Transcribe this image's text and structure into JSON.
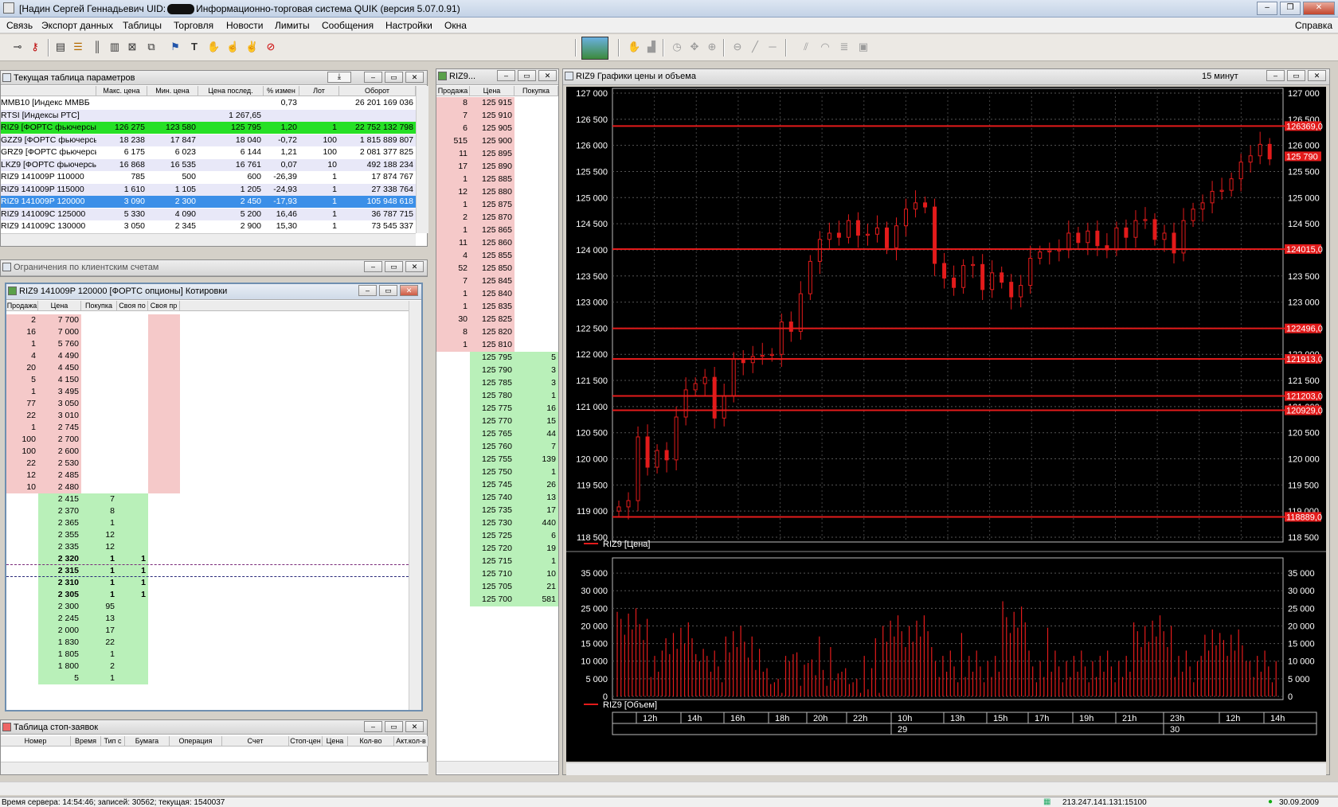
{
  "window": {
    "title_prefix": "[Надин Сергей Геннадьевич  UID:",
    "title_suffix": "Информационно-торговая система QUIK (версия 5.07.0.91)",
    "min": "–",
    "max": "❐",
    "close": "✕"
  },
  "menu": [
    "Связь",
    "Экспорт данных",
    "Таблицы",
    "Торговля",
    "Новости",
    "Лимиты",
    "Сообщения",
    "Настройки",
    "Окна"
  ],
  "menu_help": "Справка",
  "params": {
    "title": "Текущая таблица параметров",
    "headers": [
      "",
      "Макс. цена",
      "Мин. цена",
      "Цена послед.",
      "% измен",
      "Лот",
      "Оборот"
    ],
    "rows": [
      {
        "name": "MMB10 [Индекс ММВБ",
        "max": "",
        "min": "",
        "last": "",
        "chg": "0,73",
        "lot": "",
        "turn": "26 201 169 036",
        "hl": "none"
      },
      {
        "name": "RTSI [Индексы РТС]",
        "max": "",
        "min": "",
        "last": "1 267,65",
        "chg": "",
        "lot": "",
        "turn": "",
        "hl": "lav"
      },
      {
        "name": "RIZ9 [ФОРТС фьючерсы]",
        "max": "126 275",
        "min": "123 580",
        "last": "125 795",
        "chg": "1,20",
        "lot": "1",
        "turn": "22 752 132 798",
        "hl": "green"
      },
      {
        "name": "GZZ9 [ФОРТС фьючерсы",
        "max": "18 238",
        "min": "17 847",
        "last": "18 040",
        "chg": "-0,72",
        "lot": "100",
        "turn": "1 815 889 807",
        "hl": "lav"
      },
      {
        "name": "GRZ9 [ФОРТС фьючерсы",
        "max": "6 175",
        "min": "6 023",
        "last": "6 144",
        "chg": "1,21",
        "lot": "100",
        "turn": "2 081 377 825",
        "hl": "none"
      },
      {
        "name": "LKZ9 [ФОРТС фьючерсы",
        "max": "16 868",
        "min": "16 535",
        "last": "16 761",
        "chg": "0,07",
        "lot": "10",
        "turn": "492 188 234",
        "hl": "lav"
      },
      {
        "name": "RIZ9     141009P 110000",
        "max": "785",
        "min": "500",
        "last": "600",
        "chg": "-26,39",
        "lot": "1",
        "turn": "17 874 767",
        "hl": "none"
      },
      {
        "name": "RIZ9     141009P 115000",
        "max": "1 610",
        "min": "1 105",
        "last": "1 205",
        "chg": "-24,93",
        "lot": "1",
        "turn": "27 338 764",
        "hl": "lav"
      },
      {
        "name": "RIZ9     141009P 120000",
        "max": "3 090",
        "min": "2 300",
        "last": "2 450",
        "chg": "-17,93",
        "lot": "1",
        "turn": "105 948 618",
        "hl": "blue"
      },
      {
        "name": "RIZ9     141009C 125000",
        "max": "5 330",
        "min": "4 090",
        "last": "5 200",
        "chg": "16,46",
        "lot": "1",
        "turn": "36 787 715",
        "hl": "lav"
      },
      {
        "name": "RIZ9     141009C 130000",
        "max": "3 050",
        "min": "2 345",
        "last": "2 900",
        "chg": "15,30",
        "lot": "1",
        "turn": "73 545 337",
        "hl": "none"
      }
    ]
  },
  "limits_title": "Ограничения по клиентским счетам",
  "options_quotes": {
    "title": "RIZ9      141009P 120000 [ФОРТС опционы] Котировки",
    "headers": [
      "Продажа",
      "Цена",
      "Покупка",
      "Своя по",
      "Своя пр"
    ],
    "rows": [
      [
        "2",
        "7 700",
        "",
        "",
        ""
      ],
      [
        "16",
        "7 000",
        "",
        "",
        ""
      ],
      [
        "1",
        "5 760",
        "",
        "",
        ""
      ],
      [
        "4",
        "4 490",
        "",
        "",
        ""
      ],
      [
        "20",
        "4 450",
        "",
        "",
        ""
      ],
      [
        "5",
        "4 150",
        "",
        "",
        ""
      ],
      [
        "1",
        "3 495",
        "",
        "",
        ""
      ],
      [
        "77",
        "3 050",
        "",
        "",
        ""
      ],
      [
        "22",
        "3 010",
        "",
        "",
        ""
      ],
      [
        "1",
        "2 745",
        "",
        "",
        ""
      ],
      [
        "100",
        "2 700",
        "",
        "",
        ""
      ],
      [
        "100",
        "2 600",
        "",
        "",
        ""
      ],
      [
        "22",
        "2 530",
        "",
        "",
        ""
      ],
      [
        "12",
        "2 485",
        "",
        "",
        ""
      ],
      [
        "10",
        "2 480",
        "",
        "",
        ""
      ],
      [
        "",
        "2 415",
        "7",
        "",
        ""
      ],
      [
        "",
        "2 370",
        "8",
        "",
        ""
      ],
      [
        "",
        "2 365",
        "1",
        "",
        ""
      ],
      [
        "",
        "2 355",
        "12",
        "",
        ""
      ],
      [
        "",
        "2 335",
        "12",
        "",
        ""
      ],
      [
        "",
        "2 320",
        "1",
        "1",
        ""
      ],
      [
        "",
        "2 315",
        "1",
        "1",
        ""
      ],
      [
        "",
        "2 310",
        "1",
        "1",
        ""
      ],
      [
        "",
        "2 305",
        "1",
        "1",
        ""
      ],
      [
        "",
        "2 300",
        "95",
        "",
        ""
      ],
      [
        "",
        "2 245",
        "13",
        "",
        ""
      ],
      [
        "",
        "2 000",
        "17",
        "",
        ""
      ],
      [
        "",
        "1 830",
        "22",
        "",
        ""
      ],
      [
        "",
        "1 805",
        "1",
        "",
        ""
      ],
      [
        "",
        "1 800",
        "2",
        "",
        ""
      ],
      [
        "",
        "5",
        "1",
        "",
        ""
      ]
    ]
  },
  "stop_orders": {
    "title": "Таблица стоп-заявок",
    "headers": [
      "Номер",
      "Время",
      "Тип с",
      "Бумага",
      "Операция",
      "Счет",
      "Стоп-цен",
      "Цена",
      "Кол-во",
      "Акт.кол-в"
    ]
  },
  "riz_quotes": {
    "title": "RIZ9...",
    "headers": [
      "Продажа",
      "Цена",
      "Покупка"
    ],
    "sell": [
      [
        "8",
        "125 915"
      ],
      [
        "7",
        "125 910"
      ],
      [
        "6",
        "125 905"
      ],
      [
        "515",
        "125 900"
      ],
      [
        "11",
        "125 895"
      ],
      [
        "17",
        "125 890"
      ],
      [
        "1",
        "125 885"
      ],
      [
        "12",
        "125 880"
      ],
      [
        "1",
        "125 875"
      ],
      [
        "2",
        "125 870"
      ],
      [
        "1",
        "125 865"
      ],
      [
        "11",
        "125 860"
      ],
      [
        "4",
        "125 855"
      ],
      [
        "52",
        "125 850"
      ],
      [
        "7",
        "125 845"
      ],
      [
        "1",
        "125 840"
      ],
      [
        "1",
        "125 835"
      ],
      [
        "30",
        "125 825"
      ],
      [
        "8",
        "125 820"
      ],
      [
        "1",
        "125 810"
      ]
    ],
    "buy": [
      [
        "125 795",
        "5"
      ],
      [
        "125 790",
        "3"
      ],
      [
        "125 785",
        "3"
      ],
      [
        "125 780",
        "1"
      ],
      [
        "125 775",
        "16"
      ],
      [
        "125 770",
        "15"
      ],
      [
        "125 765",
        "44"
      ],
      [
        "125 760",
        "7"
      ],
      [
        "125 755",
        "139"
      ],
      [
        "125 750",
        "1"
      ],
      [
        "125 745",
        "26"
      ],
      [
        "125 740",
        "13"
      ],
      [
        "125 735",
        "17"
      ],
      [
        "125 730",
        "440"
      ],
      [
        "125 725",
        "6"
      ],
      [
        "125 720",
        "19"
      ],
      [
        "125 715",
        "1"
      ],
      [
        "125 710",
        "10"
      ],
      [
        "125 705",
        "21"
      ],
      [
        "125 700",
        "581"
      ]
    ]
  },
  "chart_panel": {
    "title": "RIZ9 Графики цены и объема",
    "interval": "15 минут"
  },
  "chart_data": [
    {
      "type": "line",
      "subtype": "candlestick",
      "title": "",
      "series": [
        {
          "name": "RIZ9 [Цена]",
          "color": "#e31b1b"
        }
      ],
      "ylim": [
        118500,
        127000
      ],
      "yticks": [
        "127 000",
        "126 500",
        "126 000",
        "125 500",
        "125 000",
        "124 500",
        "124 000",
        "123 500",
        "123 000",
        "122 500",
        "122 000",
        "121 500",
        "121 000",
        "120 500",
        "120 000",
        "119 500",
        "119 000",
        "118 500"
      ],
      "price_close": [
        119200,
        120300,
        119900,
        120100,
        120800,
        121200,
        121500,
        120900,
        121200,
        121800,
        121900,
        122100,
        122000,
        122500,
        123100,
        123900,
        124200,
        124300,
        124500,
        124400,
        124300,
        124100,
        124400,
        124900,
        124700,
        123800,
        123400,
        123700,
        123600,
        123300,
        123500,
        123100,
        123200,
        123900,
        124100,
        124000,
        124200,
        124300,
        124200,
        124000,
        124300,
        124500,
        124700,
        124200,
        124000,
        124500,
        124900,
        125000,
        125200,
        125300,
        125800,
        125900,
        125800
      ],
      "levels": [
        {
          "value": 126369,
          "label": "126369,0"
        },
        {
          "value": 124015,
          "label": "124015,0"
        },
        {
          "value": 122496,
          "label": "122496,0"
        },
        {
          "value": 121913,
          "label": "121913,0"
        },
        {
          "value": 121203,
          "label": "121203,0"
        },
        {
          "value": 120929,
          "label": "120929,0"
        },
        {
          "value": 118889,
          "label": "118889,0"
        }
      ],
      "last_label": "125 790"
    },
    {
      "type": "bar",
      "title": "",
      "series": [
        {
          "name": "RIZ9 [Объем]",
          "color": "#e31b1b"
        }
      ],
      "ylim": [
        0,
        37500
      ],
      "yticks": [
        "35 000",
        "30 000",
        "25 000",
        "20 000",
        "15 000",
        "10 000",
        "5 000",
        "0"
      ],
      "xticks": [
        "12h",
        "14h",
        "16h",
        "18h",
        "20h",
        "22h",
        "10h",
        "13h",
        "15h",
        "17h",
        "19h",
        "21h",
        "23h",
        "12h",
        "14h"
      ],
      "days": [
        "29",
        "30"
      ]
    }
  ],
  "status": {
    "left": "Время сервера: 14:54:46; записей: 30562; текущая: 1540037",
    "ip": "213.247.141.131:15100",
    "date": "30.09.2009"
  }
}
